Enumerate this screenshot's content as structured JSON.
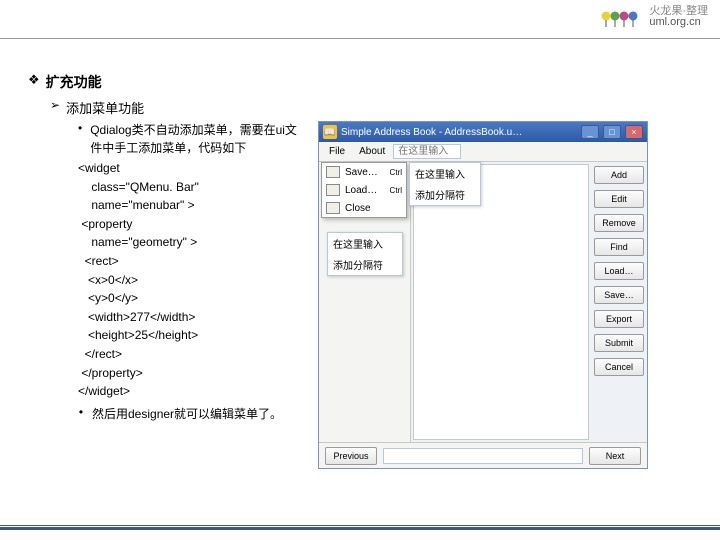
{
  "brand": {
    "cn": "火龙果·整理",
    "url": "uml.org.cn"
  },
  "outline": {
    "l1": "扩充功能",
    "l2": "添加菜单功能",
    "b1": "Qdialog类不自动添加菜单，需要在ui文件中手工添加菜单，代码如下",
    "b2": "然后用designer就可以编辑菜单了。"
  },
  "code": {
    "c0": "<widget",
    "c1": "    class=\"QMenu. Bar\"",
    "c2": "    name=\"menubar\" >",
    "c3": " <property",
    "c4": "    name=\"geometry\" >",
    "c5": "  <rect>",
    "c6": "   <x>0</x>",
    "c7": "   <y>0</y>",
    "c8": "   <width>277</width>",
    "c9": "   <height>25</height>",
    "c10": "  </rect>",
    "c11": " </property>",
    "c12": "</widget>"
  },
  "app": {
    "title": "Simple Address Book - AddressBook.u…",
    "menu": {
      "file": "File",
      "about": "About",
      "input": "在这里输入"
    },
    "dropdown": {
      "save": "Save…",
      "save_sub": "Ctrl",
      "load": "Load…",
      "load_sub": "Ctrl",
      "close": "Close"
    },
    "dd_side": {
      "a": "在这里输入",
      "b": "添加分隔符"
    },
    "subpanel": {
      "a": "在这里输入",
      "b": "添加分隔符"
    },
    "buttons": {
      "add": "Add",
      "edit": "Edit",
      "remove": "Remove",
      "find": "Find",
      "load": "Load…",
      "save": "Save…",
      "export": "Export",
      "submit": "Submit",
      "cancel": "Cancel"
    },
    "nav": {
      "prev": "Previous",
      "next": "Next"
    }
  }
}
